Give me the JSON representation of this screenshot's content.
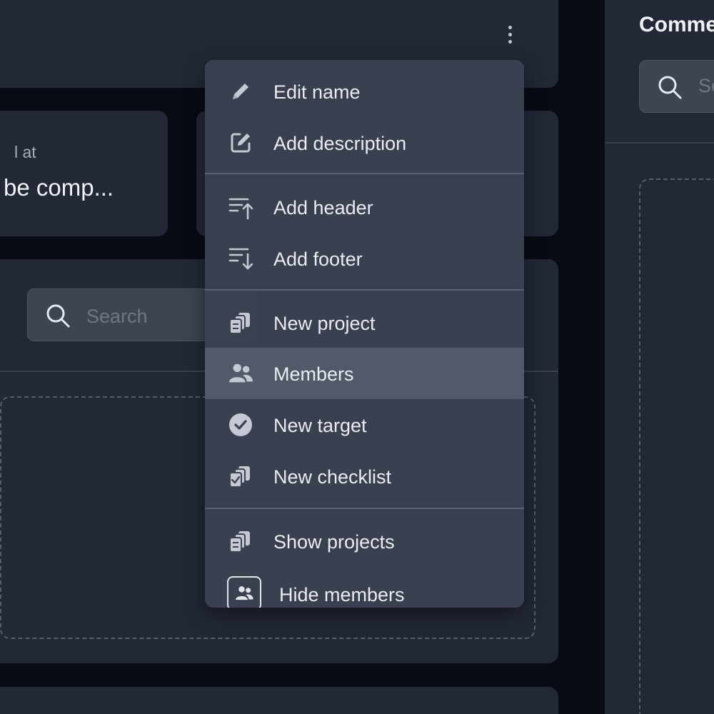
{
  "header": {
    "more_icon": "kebab-vertical-icon"
  },
  "stats": {
    "label": "l at",
    "value": "be comp..."
  },
  "main": {
    "search_placeholder": "Search",
    "search_icon": "search-icon"
  },
  "comments": {
    "title": "Comme",
    "search_placeholder": "Se"
  },
  "menu": {
    "items": [
      {
        "label": "Edit name",
        "icon": "pencil-icon"
      },
      {
        "label": "Add description",
        "icon": "edit-square-icon"
      },
      {
        "label": "Add header",
        "icon": "sort-up-icon"
      },
      {
        "label": "Add footer",
        "icon": "sort-down-icon"
      },
      {
        "label": "New project",
        "icon": "copy-document-icon"
      },
      {
        "label": "Members",
        "icon": "users-icon",
        "active": true
      },
      {
        "label": "New target",
        "icon": "check-circle-icon"
      },
      {
        "label": "New checklist",
        "icon": "checklist-copy-icon"
      },
      {
        "label": "Show projects",
        "icon": "copy-document-icon"
      },
      {
        "label": "Hide members",
        "icon": "users-box-icon"
      }
    ]
  },
  "colors": {
    "background": "#080b14",
    "card": "#222836",
    "menu": "#3c4252",
    "menu_active": "#525a6a",
    "text": "#e9ecf1",
    "muted": "#6f7684"
  }
}
